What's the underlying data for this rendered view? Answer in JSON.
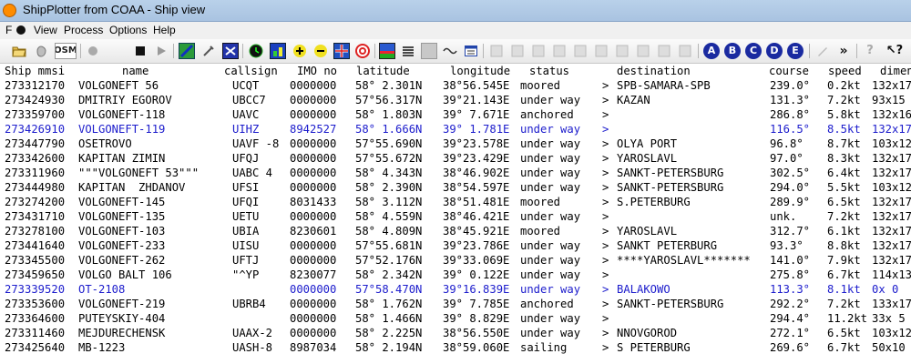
{
  "window": {
    "title": "ShipPlotter from COAA - Ship view"
  },
  "menu": [
    {
      "label": "File",
      "display": "F"
    },
    {
      "label": "View",
      "display": "View"
    },
    {
      "label": "Process",
      "display": "Process"
    },
    {
      "label": "Options",
      "display": "Options"
    },
    {
      "label": "Help",
      "display": "Help"
    }
  ],
  "toolbar": {
    "osm_label": "OSM",
    "letters": [
      "A",
      "B",
      "C",
      "D",
      "E"
    ],
    "icons": [
      "open-folder-icon",
      "pointer-icon",
      "osm-icon",
      "record-icon",
      "stop-icon",
      "play-icon",
      "map-icon",
      "tools-icon",
      "route-icon",
      "clock-icon",
      "chart-icon",
      "zoom-in-icon",
      "zoom-out-icon",
      "flag-icon",
      "target-icon",
      "color-map-icon",
      "list-icon",
      "gray-square-icon",
      "wave-icon",
      "window-icon",
      "disabled-grid-icon",
      "letter-a-icon",
      "letter-b-icon",
      "letter-c-icon",
      "letter-d-icon",
      "letter-e-icon",
      "pen-icon",
      "chevron-right-icon",
      "help-icon",
      "context-help-icon"
    ]
  },
  "colors": {
    "accent": "#1c1ccc",
    "titlebar": "#b9d1ea"
  },
  "table": {
    "columns": [
      "Ship mmsi",
      "name",
      "callsign",
      "IMO no",
      "latitude",
      "longitude",
      "status",
      "",
      "destination",
      "course",
      "speed",
      "dimen"
    ],
    "rows": [
      {
        "mmsi": "273312170",
        "name": "VOLGONEFT 56",
        "callsign": "UCQT",
        "imo": "0000000",
        "lat": "58° 2.301N",
        "lon": "38°56.545E",
        "status": "moored",
        "arrow": ">",
        "dest": "SPB-SAMARA-SPB",
        "course": "239.0°",
        "speed": "0.2kt",
        "dim": "132x17",
        "hl": false
      },
      {
        "mmsi": "273424930",
        "name": "DMITRIY EGOROV",
        "callsign": "UBCC7",
        "imo": "0000000",
        "lat": "57°56.317N",
        "lon": "39°21.143E",
        "status": "under way",
        "arrow": ">",
        "dest": "KAZAN",
        "course": "131.3°",
        "speed": "7.2kt",
        "dim": "93x15",
        "hl": false
      },
      {
        "mmsi": "273359700",
        "name": "VOLGONEFT-118",
        "callsign": "UAVC",
        "imo": "0000000",
        "lat": "58° 1.803N",
        "lon": "39° 7.671E",
        "status": "anchored",
        "arrow": ">",
        "dest": "",
        "course": "286.8°",
        "speed": "5.8kt",
        "dim": "132x16",
        "hl": false
      },
      {
        "mmsi": "273426910",
        "name": "VOLGONEFT-119",
        "callsign": "UIHZ",
        "imo": "8942527",
        "lat": "58° 1.666N",
        "lon": "39° 1.781E",
        "status": "under way",
        "arrow": ">",
        "dest": "",
        "course": "116.5°",
        "speed": "8.5kt",
        "dim": "132x17",
        "hl": true
      },
      {
        "mmsi": "273447790",
        "name": "OSETROVO",
        "callsign": "UAVF -8",
        "imo": "0000000",
        "lat": "57°55.690N",
        "lon": "39°23.578E",
        "status": "under way",
        "arrow": ">",
        "dest": "OLYA PORT",
        "course": "96.8°",
        "speed": "8.7kt",
        "dim": "103x12",
        "hl": false
      },
      {
        "mmsi": "273342600",
        "name": "KAPITAN ZIMIN",
        "callsign": "UFQJ",
        "imo": "0000000",
        "lat": "57°55.672N",
        "lon": "39°23.429E",
        "status": "under way",
        "arrow": ">",
        "dest": "YAROSLAVL",
        "course": "97.0°",
        "speed": "8.3kt",
        "dim": "132x17",
        "hl": false
      },
      {
        "mmsi": "273311960",
        "name": "\"\"\"VOLGONEFT 53\"\"\"",
        "callsign": "UABC 4",
        "imo": "0000000",
        "lat": "58° 4.343N",
        "lon": "38°46.902E",
        "status": "under way",
        "arrow": ">",
        "dest": "SANKT-PETERSBURG",
        "course": "302.5°",
        "speed": "6.4kt",
        "dim": "132x17",
        "hl": false
      },
      {
        "mmsi": "273444980",
        "name": "KAPITAN  ZHDANOV",
        "callsign": "UFSI",
        "imo": "0000000",
        "lat": "58° 2.390N",
        "lon": "38°54.597E",
        "status": "under way",
        "arrow": ">",
        "dest": "SANKT-PETERSBURG",
        "course": "294.0°",
        "speed": "5.5kt",
        "dim": "103x12",
        "hl": false
      },
      {
        "mmsi": "273274200",
        "name": "VOLGONEFT-145",
        "callsign": "UFQI",
        "imo": "8031433",
        "lat": "58° 3.112N",
        "lon": "38°51.481E",
        "status": "moored",
        "arrow": ">",
        "dest": "S.PETERBURG",
        "course": "289.9°",
        "speed": "6.5kt",
        "dim": "132x17",
        "hl": false
      },
      {
        "mmsi": "273431710",
        "name": "VOLGONEFT-135",
        "callsign": "UETU",
        "imo": "0000000",
        "lat": "58° 4.559N",
        "lon": "38°46.421E",
        "status": "under way",
        "arrow": ">",
        "dest": "",
        "course": "unk.",
        "speed": "7.2kt",
        "dim": "132x17",
        "hl": false
      },
      {
        "mmsi": "273278100",
        "name": "VOLGONEFT-103",
        "callsign": "UBIA",
        "imo": "8230601",
        "lat": "58° 4.809N",
        "lon": "38°45.921E",
        "status": "moored",
        "arrow": ">",
        "dest": "YAROSLAVL",
        "course": "312.7°",
        "speed": "6.1kt",
        "dim": "132x17",
        "hl": false
      },
      {
        "mmsi": "273441640",
        "name": "VOLGONEFT-233",
        "callsign": "UISU",
        "imo": "0000000",
        "lat": "57°55.681N",
        "lon": "39°23.786E",
        "status": "under way",
        "arrow": ">",
        "dest": "SANKT PETERBURG",
        "course": "93.3°",
        "speed": "8.8kt",
        "dim": "132x17",
        "hl": false
      },
      {
        "mmsi": "273345500",
        "name": "VOLGONEFT-262",
        "callsign": "UFTJ",
        "imo": "0000000",
        "lat": "57°52.176N",
        "lon": "39°33.069E",
        "status": "under way",
        "arrow": ">",
        "dest": "****YAROSLAVL*******",
        "course": "141.0°",
        "speed": "7.9kt",
        "dim": "132x17",
        "hl": false
      },
      {
        "mmsi": "273459650",
        "name": "VOLGO BALT 106",
        "callsign": "\"^YP",
        "imo": "8230077",
        "lat": "58° 2.342N",
        "lon": "39° 0.122E",
        "status": "under way",
        "arrow": ">",
        "dest": "",
        "course": "275.8°",
        "speed": "6.7kt",
        "dim": "114x13",
        "hl": false
      },
      {
        "mmsi": "273339520",
        "name": "OT-2108",
        "callsign": "",
        "imo": "0000000",
        "lat": "57°58.470N",
        "lon": "39°16.839E",
        "status": "under way",
        "arrow": ">",
        "dest": "BALAKOWO",
        "course": "113.3°",
        "speed": "8.1kt",
        "dim": "0x 0",
        "hl": true
      },
      {
        "mmsi": "273353600",
        "name": "VOLGONEFT-219",
        "callsign": "UBRB4",
        "imo": "0000000",
        "lat": "58° 1.762N",
        "lon": "39° 7.785E",
        "status": "anchored",
        "arrow": ">",
        "dest": "SANKT-PETERSBURG",
        "course": "292.2°",
        "speed": "7.2kt",
        "dim": "133x17",
        "hl": false
      },
      {
        "mmsi": "273364600",
        "name": "PUTEYSKIY-404",
        "callsign": "",
        "imo": "0000000",
        "lat": "58° 1.466N",
        "lon": "39° 8.829E",
        "status": "under way",
        "arrow": ">",
        "dest": "",
        "course": "294.4°",
        "speed": "11.2kt",
        "dim": "33x 5",
        "hl": false
      },
      {
        "mmsi": "273311460",
        "name": "MEJDURECHENSK",
        "callsign": "UAAX-2",
        "imo": "0000000",
        "lat": "58° 2.225N",
        "lon": "38°56.550E",
        "status": "under way",
        "arrow": ">",
        "dest": "NNOVGOROD",
        "course": "272.1°",
        "speed": "6.5kt",
        "dim": "103x12",
        "hl": false
      },
      {
        "mmsi": "273425640",
        "name": "MB-1223",
        "callsign": "UASH-8",
        "imo": "8987034",
        "lat": "58° 2.194N",
        "lon": "38°59.060E",
        "status": "sailing",
        "arrow": ">",
        "dest": "S PETERBURG",
        "course": "269.6°",
        "speed": "6.7kt",
        "dim": "50x10",
        "hl": false
      }
    ]
  }
}
